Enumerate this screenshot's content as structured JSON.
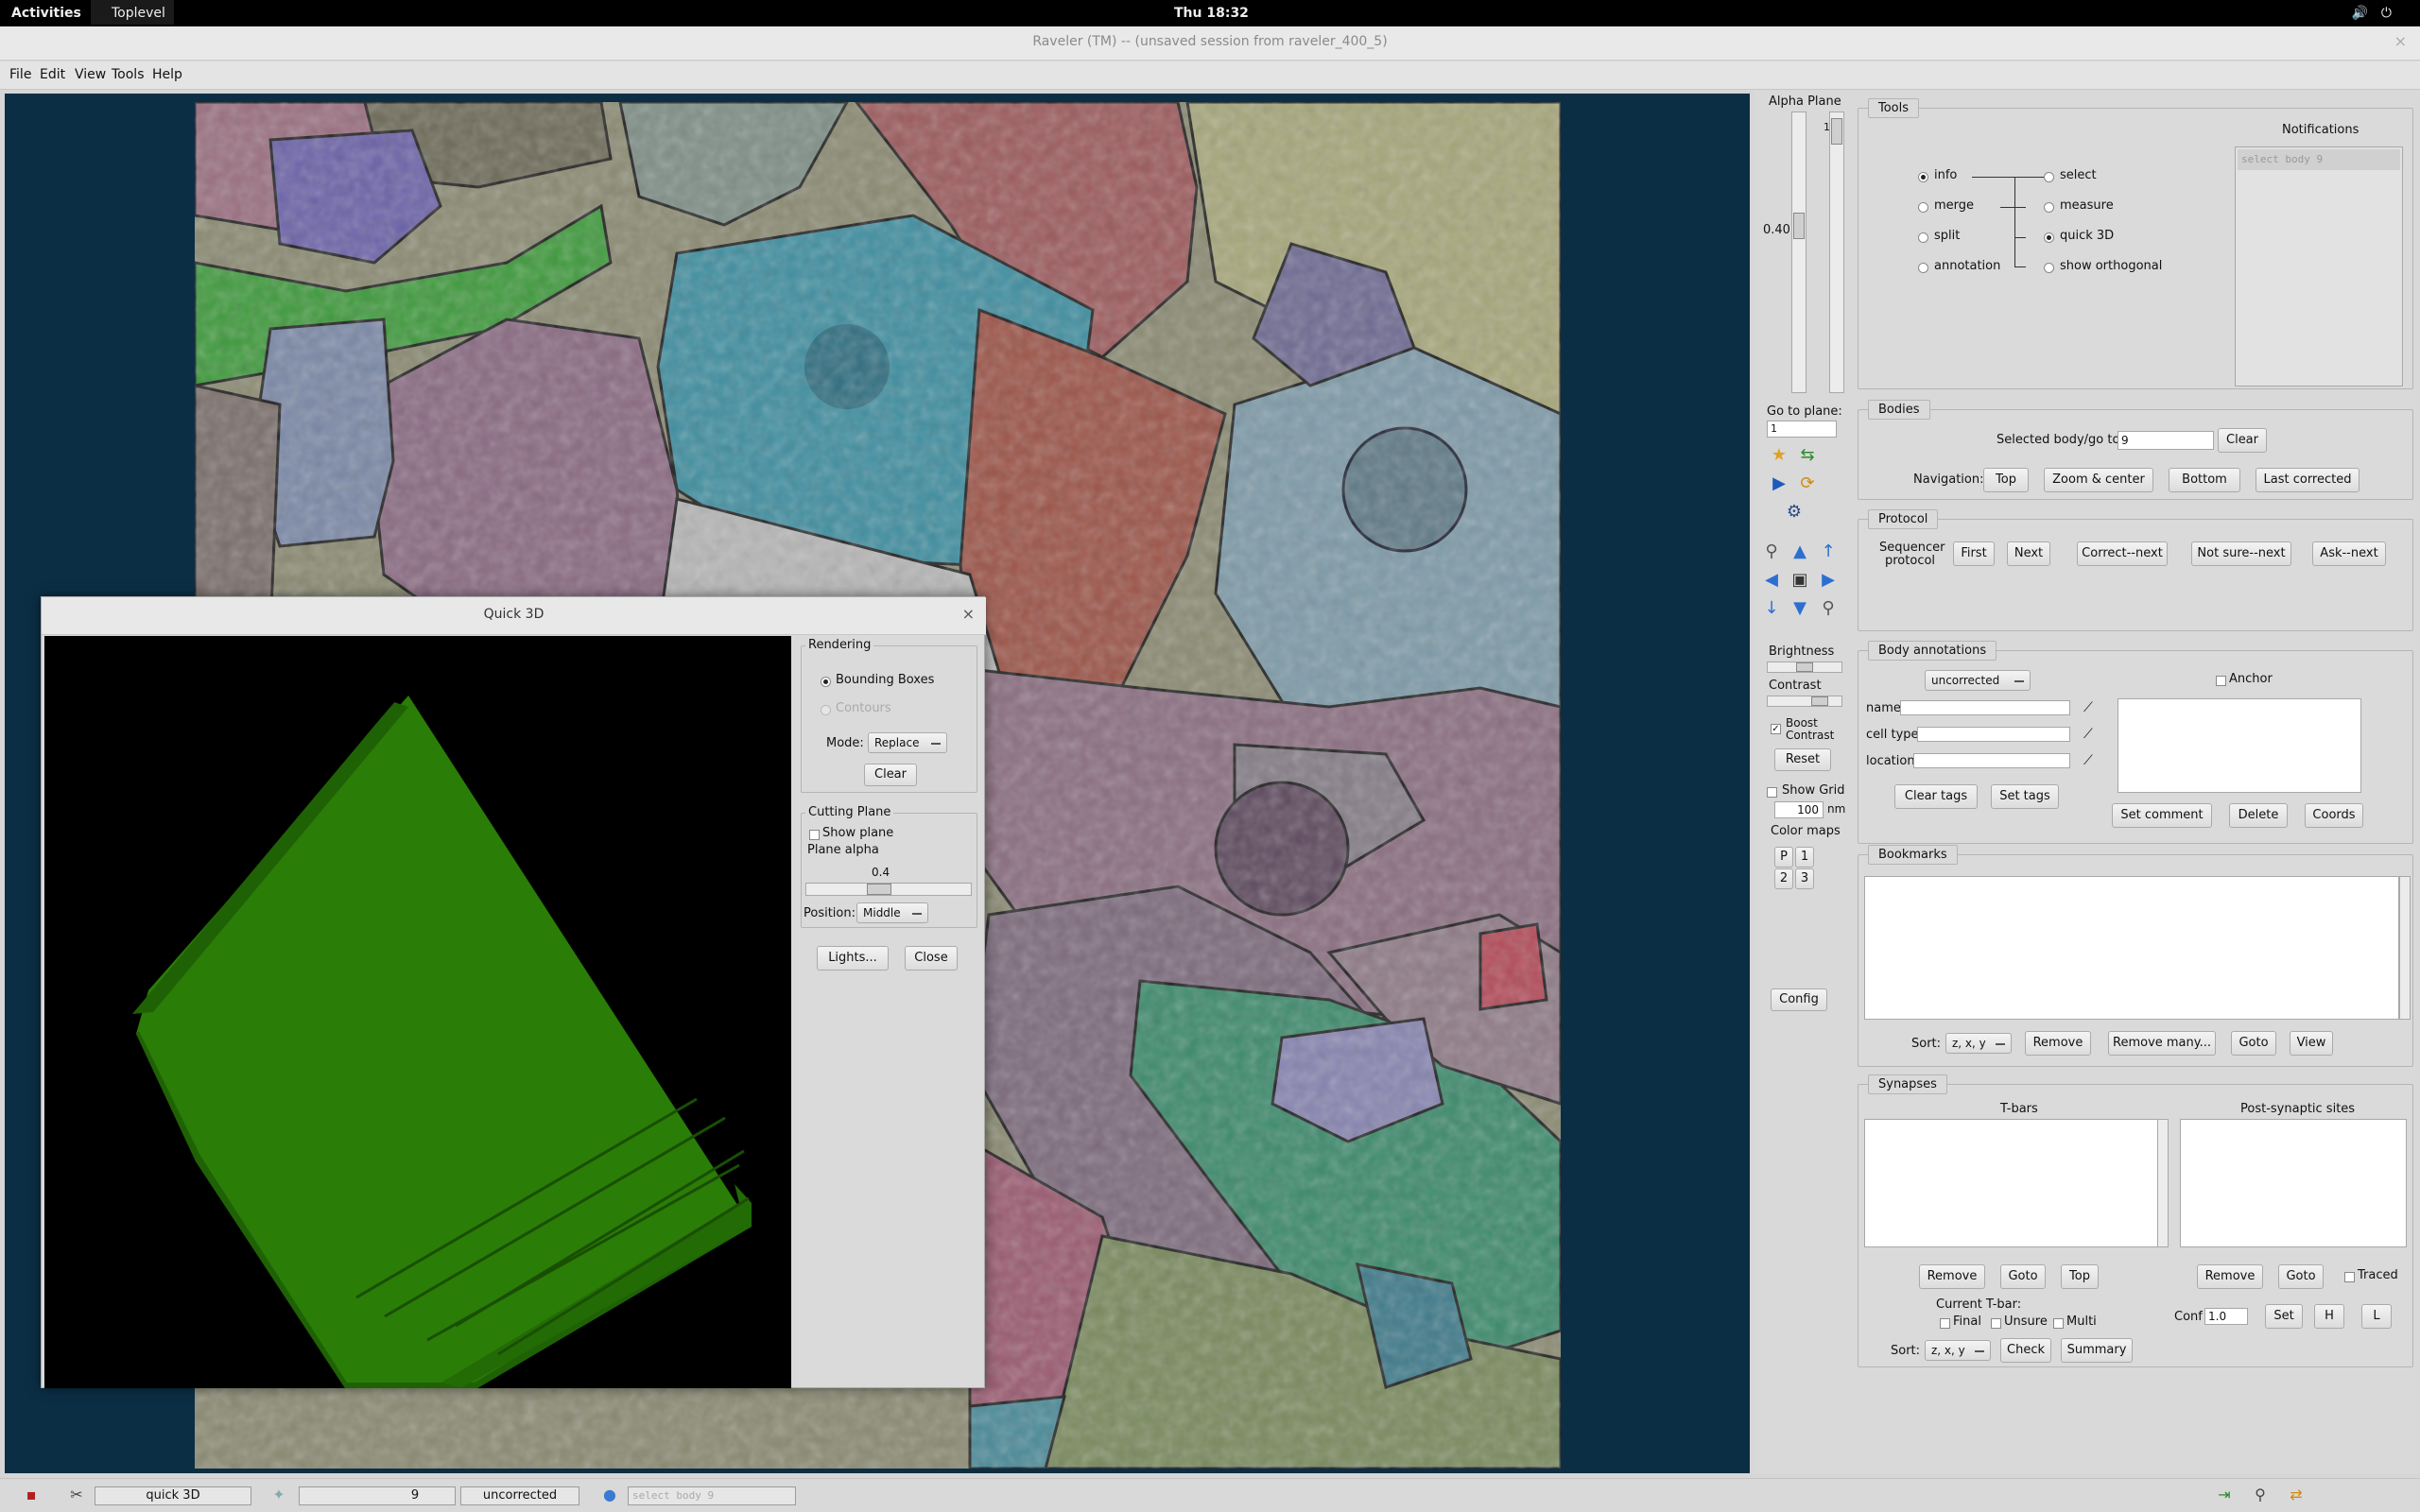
{
  "topbar": {
    "activities": "Activities",
    "toplevel": "Toplevel ▾",
    "clock": "Thu 18:32",
    "tray": "🔊⏻"
  },
  "window": {
    "title": "Raveler (TM) -- (unsaved session from raveler_400_5)",
    "close": "×"
  },
  "menu": {
    "file": "File",
    "edit": "Edit",
    "view": "View",
    "tools": "Tools",
    "help": "Help"
  },
  "side": {
    "alpha_plane": "Alpha Plane",
    "alpha_value": "0.40",
    "plane_index": "1",
    "goto_plane": "Go to plane:",
    "goto_value": "1",
    "brightness": "Brightness",
    "contrast": "Contrast",
    "boost": "Boost Contrast",
    "reset": "Reset",
    "show_grid": "Show Grid",
    "grid_value": "100",
    "grid_unit": "nm",
    "color_maps": "Color maps",
    "cm_p": "P",
    "cm_1": "1",
    "cm_2": "2",
    "cm_3": "3",
    "config": "Config"
  },
  "tools": {
    "title": "Tools",
    "left": [
      "info",
      "merge",
      "split",
      "annotation"
    ],
    "right": [
      "select",
      "measure",
      "quick 3D",
      "show orthogonal"
    ],
    "notifications_label": "Notifications",
    "notification": "select body 9"
  },
  "bodies": {
    "title": "Bodies",
    "selected_label": "Selected body/go to:",
    "selected_value": "9",
    "clear": "Clear",
    "navigation": "Navigation:",
    "top": "Top",
    "zoom": "Zoom & center",
    "bottom": "Bottom",
    "last": "Last corrected"
  },
  "protocol": {
    "title": "Protocol",
    "label1": "Sequencer",
    "label2": "protocol",
    "first": "First",
    "next": "Next",
    "correct": "Correct--next",
    "notsure": "Not sure--next",
    "ask": "Ask--next"
  },
  "annotations": {
    "title": "Body annotations",
    "status": "uncorrected",
    "anchor": "Anchor",
    "name": "name",
    "cell_type": "cell type",
    "location": "location",
    "clear_tags": "Clear tags",
    "set_tags": "Set tags",
    "set_comment": "Set comment",
    "delete": "Delete",
    "coords": "Coords"
  },
  "bookmarks": {
    "title": "Bookmarks",
    "sort": "Sort:",
    "sort_value": "z, x, y",
    "remove": "Remove",
    "remove_many": "Remove many...",
    "goto": "Goto",
    "view": "View"
  },
  "synapses": {
    "title": "Synapses",
    "tbars": "T-bars",
    "post": "Post-synaptic sites",
    "remove": "Remove",
    "goto": "Goto",
    "top": "Top",
    "remove2": "Remove",
    "goto2": "Goto",
    "traced": "Traced",
    "current": "Current T-bar:",
    "final": "Final",
    "unsure": "Unsure",
    "multi": "Multi",
    "conf": "Conf",
    "conf_value": "1.0",
    "set": "Set",
    "h": "H",
    "l": "L",
    "sort": "Sort:",
    "sort_value": "z, x, y",
    "check": "Check",
    "summary": "Summary"
  },
  "quick3d": {
    "title": "Quick 3D",
    "close_x": "×",
    "rendering": "Rendering",
    "bounding": "Bounding Boxes",
    "contours": "Contours",
    "mode": "Mode:",
    "mode_value": "Replace",
    "clear": "Clear",
    "cutting": "Cutting Plane",
    "show_plane": "Show plane",
    "plane_alpha": "Plane alpha",
    "alpha_value": "0.4",
    "position": "Position:",
    "position_value": "Middle",
    "lights": "Lights...",
    "close": "Close"
  },
  "status": {
    "tool": "quick 3D",
    "body": "9",
    "state": "uncorrected",
    "message": "select body 9"
  },
  "colors": {
    "viewer_bg": "#0b2e45",
    "body_green": "#2a7d07"
  }
}
